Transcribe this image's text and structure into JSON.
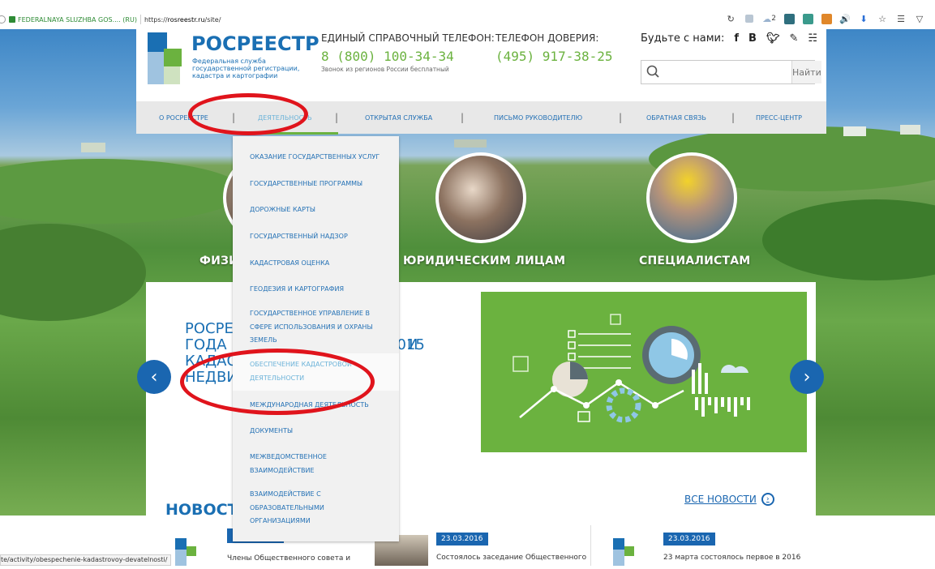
{
  "browser": {
    "site_identity": "FEDERALNAYA SLUZHBA GOS.... (RU)",
    "url_prefix": "https://",
    "url_host": "rosreestr.ru",
    "url_path": "/site/",
    "cloud_count": "2",
    "status_url": "te/activity/obespechenie-kadastrovoy-devatelnosti/"
  },
  "header": {
    "brand": "РОСРЕЕСТР",
    "brand_sub": "Федеральная служба государственной регистрации, кадастра и картографии",
    "phone1_label": "ЕДИНЫЙ СПРАВОЧНЫЙ ТЕЛЕФОН:",
    "phone1_number": "8 (800) 100-34-34",
    "phone1_note": "Звонок из регионов России бесплатный",
    "phone2_label": "ТЕЛЕФОН ДОВЕРИЯ:",
    "phone2_number": "(495) 917-38-25",
    "social_label": "Будьте с нами:",
    "social_icons": [
      "facebook-icon",
      "vk-icon",
      "twitter-icon",
      "livejournal-icon",
      "rss-icon"
    ],
    "search_placeholder": "",
    "search_button": "Найти"
  },
  "nav": {
    "items": [
      {
        "label": "О РОСРЕЕСТРЕ"
      },
      {
        "label": "ДЕЯТЕЛЬНОСТЬ"
      },
      {
        "label": "ОТКРЫТАЯ СЛУЖБА"
      },
      {
        "label": "ПИСЬМО РУКОВОДИТЕЛЮ"
      },
      {
        "label": "ОБРАТНАЯ СВЯЗЬ"
      },
      {
        "label": "ПРЕСС-ЦЕНТР"
      }
    ],
    "active": "ДЕЯТЕЛЬНОСТЬ"
  },
  "dropdown": {
    "items": [
      {
        "label": "ОКАЗАНИЕ ГОСУДАРСТВЕННЫХ УСЛУГ"
      },
      {
        "label": "ГОСУДАРСТВЕННЫЕ ПРОГРАММЫ"
      },
      {
        "label": "ДОРОЖНЫЕ КАРТЫ"
      },
      {
        "label": "ГОСУДАРСТВЕННЫЙ НАДЗОР"
      },
      {
        "label": "КАДАСТРОВАЯ ОЦЕНКА"
      },
      {
        "label": "ГЕОДЕЗИЯ И КАРТОГРАФИЯ"
      },
      {
        "label": "ГОСУДАРСТВЕННОЕ УПРАВЛЕНИЕ В СФЕРЕ ИСПОЛЬЗОВАНИЯ И ОХРАНЫ ЗЕМЕЛЬ"
      },
      {
        "label": "ОБЕСПЕЧЕНИЕ КАДАСТРОВОЙ ДЕЯТЕЛЬНОСТИ"
      },
      {
        "label": "МЕЖДУНАРОДНАЯ ДЕЯТЕЛЬНОСТЬ"
      },
      {
        "label": "ДОКУМЕНТЫ"
      },
      {
        "label": "МЕЖВЕДОМСТВЕННОЕ ВЗАИМОДЕЙСТВИЕ"
      },
      {
        "label": "ВЗАИМОДЕЙСТВИЕ С ОБРАЗОВАТЕЛЬНЫМИ ОРГАНИЗАЦИЯМИ"
      }
    ],
    "hovered": "ОБЕСПЕЧЕНИЕ КАДАСТРОВОЙ ДЕЯТЕЛЬНОСТИ"
  },
  "audiences": {
    "individuals_visible": "ФИЗИ",
    "legal": "ЮРИДИЧЕСКИМ ЛИЦАМ",
    "specialists": "СПЕЦИАЛИСТАМ"
  },
  "slider": {
    "title_line1_left": "РОСРЕ",
    "title_line1_right": "И 2015",
    "title_line2_left": "ГОДА Г",
    "title_line2_right": "И",
    "title_line3_left": "КАДАС",
    "title_line4_left": "НЕДВИ"
  },
  "news": {
    "title_visible": "НОВОСТ",
    "all_news": "ВСЕ НОВОСТИ",
    "cards": [
      {
        "date": "",
        "text": "Члены Общественного совета и"
      },
      {
        "date": "23.03.2016",
        "text": "Состоялось заседание Общественного"
      },
      {
        "date": "23.03.2016",
        "text": "23 марта состоялось первое в 2016"
      }
    ]
  },
  "colors": {
    "brand_blue": "#1a6fb3",
    "brand_green": "#6bb23f",
    "annotation_red": "#e0141c"
  }
}
